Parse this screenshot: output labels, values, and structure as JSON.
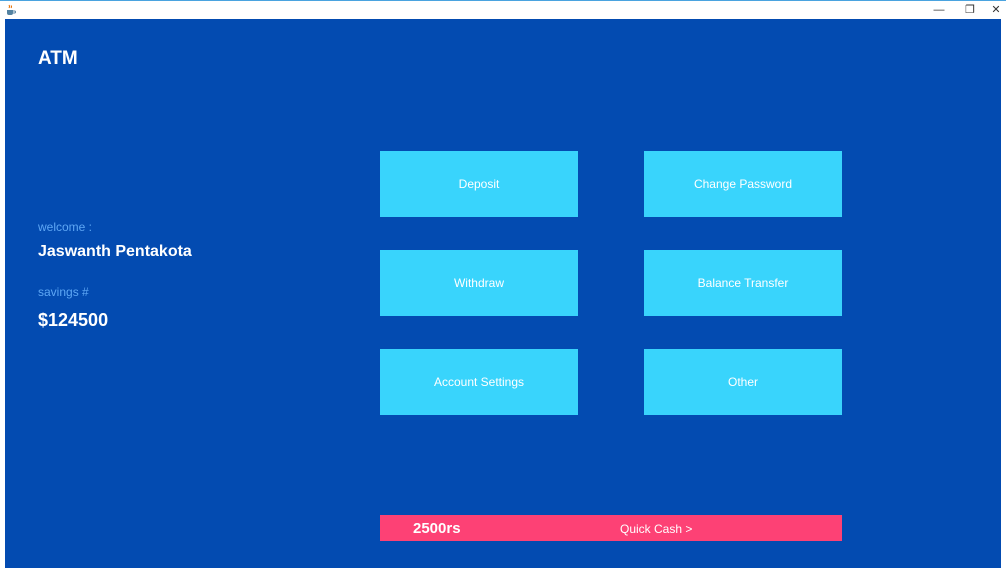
{
  "window": {
    "minimize_glyph": "—",
    "maximize_glyph": "❐",
    "close_glyph": "✕"
  },
  "app": {
    "title": "ATM"
  },
  "account": {
    "welcome_label": "welcome :",
    "user_name": "Jaswanth Pentakota",
    "savings_label": "savings #",
    "balance": "$124500"
  },
  "menu": {
    "deposit": "Deposit",
    "change_password": "Change Password",
    "withdraw": "Withdraw",
    "balance_transfer": "Balance Transfer",
    "account_settings": "Account Settings",
    "other": "Other"
  },
  "quick_cash": {
    "amount": "2500rs",
    "label": "Quick Cash  >"
  },
  "colors": {
    "background": "#034bb1",
    "button": "#39d4fc",
    "quick_cash": "#fd4175",
    "label_accent": "#5ea7f5"
  },
  "icons": {
    "app": "java-cup-icon"
  }
}
